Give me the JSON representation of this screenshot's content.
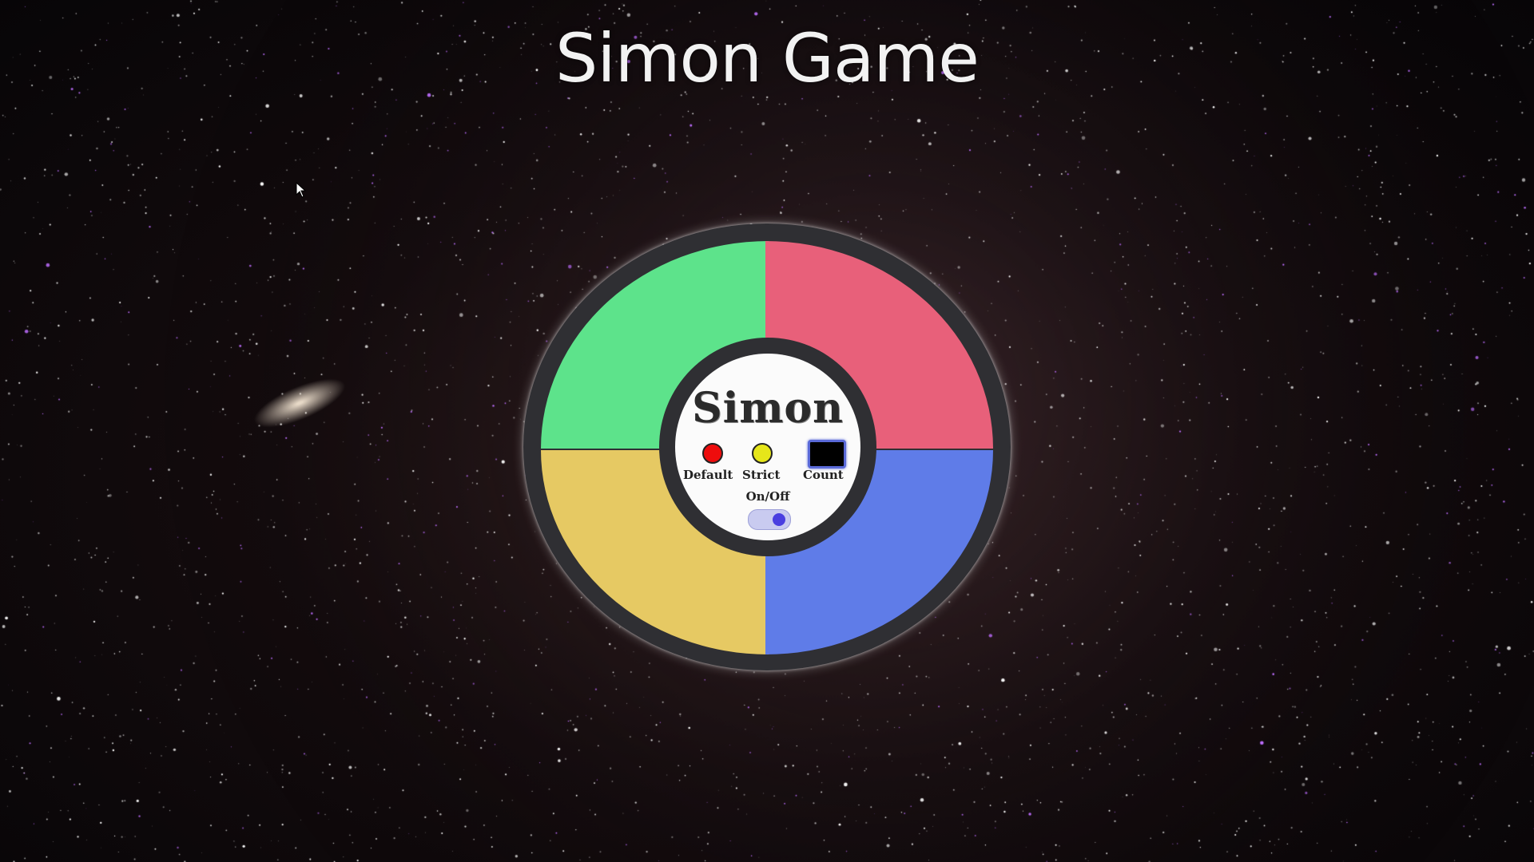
{
  "page": {
    "title": "Simon Game"
  },
  "board": {
    "logo": "Simon",
    "pads": [
      {
        "name": "green",
        "color": "#5de38b"
      },
      {
        "name": "red",
        "color": "#e8607a"
      },
      {
        "name": "yellow",
        "color": "#e6c963"
      },
      {
        "name": "blue",
        "color": "#5f7ce8"
      }
    ],
    "controls": {
      "default_label": "Default",
      "strict_label": "Strict",
      "count_label": "Count",
      "count_value": "",
      "onoff_label": "On/Off",
      "power_on": true,
      "default_led_color": "#ee0d0d",
      "strict_led_color": "#e6e61a"
    }
  },
  "background": {
    "theme": "starfield"
  }
}
